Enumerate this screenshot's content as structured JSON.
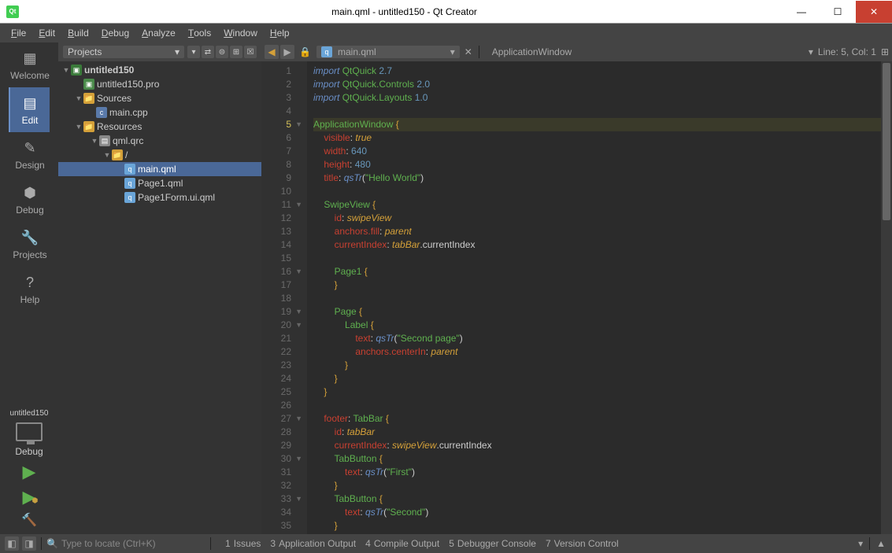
{
  "window": {
    "title": "main.qml - untitled150 - Qt Creator"
  },
  "menubar": [
    "File",
    "Edit",
    "Build",
    "Debug",
    "Analyze",
    "Tools",
    "Window",
    "Help"
  ],
  "activitybar": {
    "items": [
      {
        "label": "Welcome"
      },
      {
        "label": "Edit"
      },
      {
        "label": "Design"
      },
      {
        "label": "Debug"
      },
      {
        "label": "Projects"
      },
      {
        "label": "Help"
      }
    ],
    "kit": "untitled150",
    "config": "Debug"
  },
  "sidebar": {
    "selector": "Projects",
    "tree": {
      "project": "untitled150",
      "profile": "untitled150.pro",
      "sources": "Sources",
      "maincpp": "main.cpp",
      "resources": "Resources",
      "qrc": "qml.qrc",
      "slash": "/",
      "mainqml": "main.qml",
      "page1": "Page1.qml",
      "page1form": "Page1Form.ui.qml"
    }
  },
  "editor": {
    "file": "main.qml",
    "breadcrumb": "ApplicationWindow",
    "lineCol": "Line: 5, Col: 1",
    "code_lines": [
      {
        "n": 1,
        "f": "",
        "tokens": [
          [
            "kw-imp",
            "import"
          ],
          [
            "op",
            " "
          ],
          [
            "mod",
            "QtQuick"
          ],
          [
            "op",
            " "
          ],
          [
            "num",
            "2.7"
          ]
        ]
      },
      {
        "n": 2,
        "f": "",
        "tokens": [
          [
            "kw-imp",
            "import"
          ],
          [
            "op",
            " "
          ],
          [
            "mod",
            "QtQuick.Controls"
          ],
          [
            "op",
            " "
          ],
          [
            "num",
            "2.0"
          ]
        ]
      },
      {
        "n": 3,
        "f": "",
        "tokens": [
          [
            "kw-imp",
            "import"
          ],
          [
            "op",
            " "
          ],
          [
            "mod",
            "QtQuick.Layouts"
          ],
          [
            "op",
            " "
          ],
          [
            "num",
            "1.0"
          ]
        ]
      },
      {
        "n": 4,
        "f": "",
        "tokens": []
      },
      {
        "n": 5,
        "f": "▼",
        "current": true,
        "tokens": [
          [
            "type",
            "ApplicationWindow"
          ],
          [
            "op",
            " "
          ],
          [
            "brace",
            "{"
          ]
        ]
      },
      {
        "n": 6,
        "f": "",
        "tokens": [
          [
            "op",
            "    "
          ],
          [
            "prop",
            "visible"
          ],
          [
            "op",
            ": "
          ],
          [
            "val-id",
            "true"
          ]
        ]
      },
      {
        "n": 7,
        "f": "",
        "tokens": [
          [
            "op",
            "    "
          ],
          [
            "prop",
            "width"
          ],
          [
            "op",
            ": "
          ],
          [
            "num",
            "640"
          ]
        ]
      },
      {
        "n": 8,
        "f": "",
        "tokens": [
          [
            "op",
            "    "
          ],
          [
            "prop",
            "height"
          ],
          [
            "op",
            ": "
          ],
          [
            "num",
            "480"
          ]
        ]
      },
      {
        "n": 9,
        "f": "",
        "tokens": [
          [
            "op",
            "    "
          ],
          [
            "prop",
            "title"
          ],
          [
            "op",
            ": "
          ],
          [
            "fn",
            "qsTr"
          ],
          [
            "op",
            "("
          ],
          [
            "str",
            "\"Hello World\""
          ],
          [
            "op",
            ")"
          ]
        ]
      },
      {
        "n": 10,
        "f": "",
        "tokens": []
      },
      {
        "n": 11,
        "f": "▼",
        "tokens": [
          [
            "op",
            "    "
          ],
          [
            "type",
            "SwipeView"
          ],
          [
            "op",
            " "
          ],
          [
            "brace",
            "{"
          ]
        ]
      },
      {
        "n": 12,
        "f": "",
        "tokens": [
          [
            "op",
            "        "
          ],
          [
            "prop",
            "id"
          ],
          [
            "op",
            ": "
          ],
          [
            "ident",
            "swipeView"
          ]
        ]
      },
      {
        "n": 13,
        "f": "",
        "tokens": [
          [
            "op",
            "        "
          ],
          [
            "prop",
            "anchors.fill"
          ],
          [
            "op",
            ": "
          ],
          [
            "ident",
            "parent"
          ]
        ]
      },
      {
        "n": 14,
        "f": "",
        "tokens": [
          [
            "op",
            "        "
          ],
          [
            "prop",
            "currentIndex"
          ],
          [
            "op",
            ": "
          ],
          [
            "ident",
            "tabBar"
          ],
          [
            "op",
            ".currentIndex"
          ]
        ]
      },
      {
        "n": 15,
        "f": "",
        "tokens": []
      },
      {
        "n": 16,
        "f": "▼",
        "tokens": [
          [
            "op",
            "        "
          ],
          [
            "type",
            "Page1"
          ],
          [
            "op",
            " "
          ],
          [
            "brace",
            "{"
          ]
        ]
      },
      {
        "n": 17,
        "f": "",
        "tokens": [
          [
            "op",
            "        "
          ],
          [
            "brace",
            "}"
          ]
        ]
      },
      {
        "n": 18,
        "f": "",
        "tokens": []
      },
      {
        "n": 19,
        "f": "▼",
        "tokens": [
          [
            "op",
            "        "
          ],
          [
            "type",
            "Page"
          ],
          [
            "op",
            " "
          ],
          [
            "brace",
            "{"
          ]
        ]
      },
      {
        "n": 20,
        "f": "▼",
        "tokens": [
          [
            "op",
            "            "
          ],
          [
            "type",
            "Label"
          ],
          [
            "op",
            " "
          ],
          [
            "brace",
            "{"
          ]
        ]
      },
      {
        "n": 21,
        "f": "",
        "tokens": [
          [
            "op",
            "                "
          ],
          [
            "prop",
            "text"
          ],
          [
            "op",
            ": "
          ],
          [
            "fn",
            "qsTr"
          ],
          [
            "op",
            "("
          ],
          [
            "str",
            "\"Second page\""
          ],
          [
            "op",
            ")"
          ]
        ]
      },
      {
        "n": 22,
        "f": "",
        "tokens": [
          [
            "op",
            "                "
          ],
          [
            "prop",
            "anchors.centerIn"
          ],
          [
            "op",
            ": "
          ],
          [
            "ident",
            "parent"
          ]
        ]
      },
      {
        "n": 23,
        "f": "",
        "tokens": [
          [
            "op",
            "            "
          ],
          [
            "brace",
            "}"
          ]
        ]
      },
      {
        "n": 24,
        "f": "",
        "tokens": [
          [
            "op",
            "        "
          ],
          [
            "brace",
            "}"
          ]
        ]
      },
      {
        "n": 25,
        "f": "",
        "tokens": [
          [
            "op",
            "    "
          ],
          [
            "brace",
            "}"
          ]
        ]
      },
      {
        "n": 26,
        "f": "",
        "tokens": []
      },
      {
        "n": 27,
        "f": "▼",
        "tokens": [
          [
            "op",
            "    "
          ],
          [
            "prop",
            "footer"
          ],
          [
            "op",
            ": "
          ],
          [
            "type",
            "TabBar"
          ],
          [
            "op",
            " "
          ],
          [
            "brace",
            "{"
          ]
        ]
      },
      {
        "n": 28,
        "f": "",
        "tokens": [
          [
            "op",
            "        "
          ],
          [
            "prop",
            "id"
          ],
          [
            "op",
            ": "
          ],
          [
            "ident",
            "tabBar"
          ]
        ]
      },
      {
        "n": 29,
        "f": "",
        "tokens": [
          [
            "op",
            "        "
          ],
          [
            "prop",
            "currentIndex"
          ],
          [
            "op",
            ": "
          ],
          [
            "ident",
            "swipeView"
          ],
          [
            "op",
            ".currentIndex"
          ]
        ]
      },
      {
        "n": 30,
        "f": "▼",
        "tokens": [
          [
            "op",
            "        "
          ],
          [
            "type",
            "TabButton"
          ],
          [
            "op",
            " "
          ],
          [
            "brace",
            "{"
          ]
        ]
      },
      {
        "n": 31,
        "f": "",
        "tokens": [
          [
            "op",
            "            "
          ],
          [
            "prop",
            "text"
          ],
          [
            "op",
            ": "
          ],
          [
            "fn",
            "qsTr"
          ],
          [
            "op",
            "("
          ],
          [
            "str",
            "\"First\""
          ],
          [
            "op",
            ")"
          ]
        ]
      },
      {
        "n": 32,
        "f": "",
        "tokens": [
          [
            "op",
            "        "
          ],
          [
            "brace",
            "}"
          ]
        ]
      },
      {
        "n": 33,
        "f": "▼",
        "tokens": [
          [
            "op",
            "        "
          ],
          [
            "type",
            "TabButton"
          ],
          [
            "op",
            " "
          ],
          [
            "brace",
            "{"
          ]
        ]
      },
      {
        "n": 34,
        "f": "",
        "tokens": [
          [
            "op",
            "            "
          ],
          [
            "prop",
            "text"
          ],
          [
            "op",
            ": "
          ],
          [
            "fn",
            "qsTr"
          ],
          [
            "op",
            "("
          ],
          [
            "str",
            "\"Second\""
          ],
          [
            "op",
            ")"
          ]
        ]
      },
      {
        "n": 35,
        "f": "",
        "tokens": [
          [
            "op",
            "        "
          ],
          [
            "brace",
            "}"
          ]
        ]
      }
    ]
  },
  "statusbar": {
    "locator_placeholder": "Type to locate (Ctrl+K)",
    "tabs": [
      {
        "num": "1",
        "label": "Issues"
      },
      {
        "num": "3",
        "label": "Application Output"
      },
      {
        "num": "4",
        "label": "Compile Output"
      },
      {
        "num": "5",
        "label": "Debugger Console"
      },
      {
        "num": "7",
        "label": "Version Control"
      }
    ]
  }
}
